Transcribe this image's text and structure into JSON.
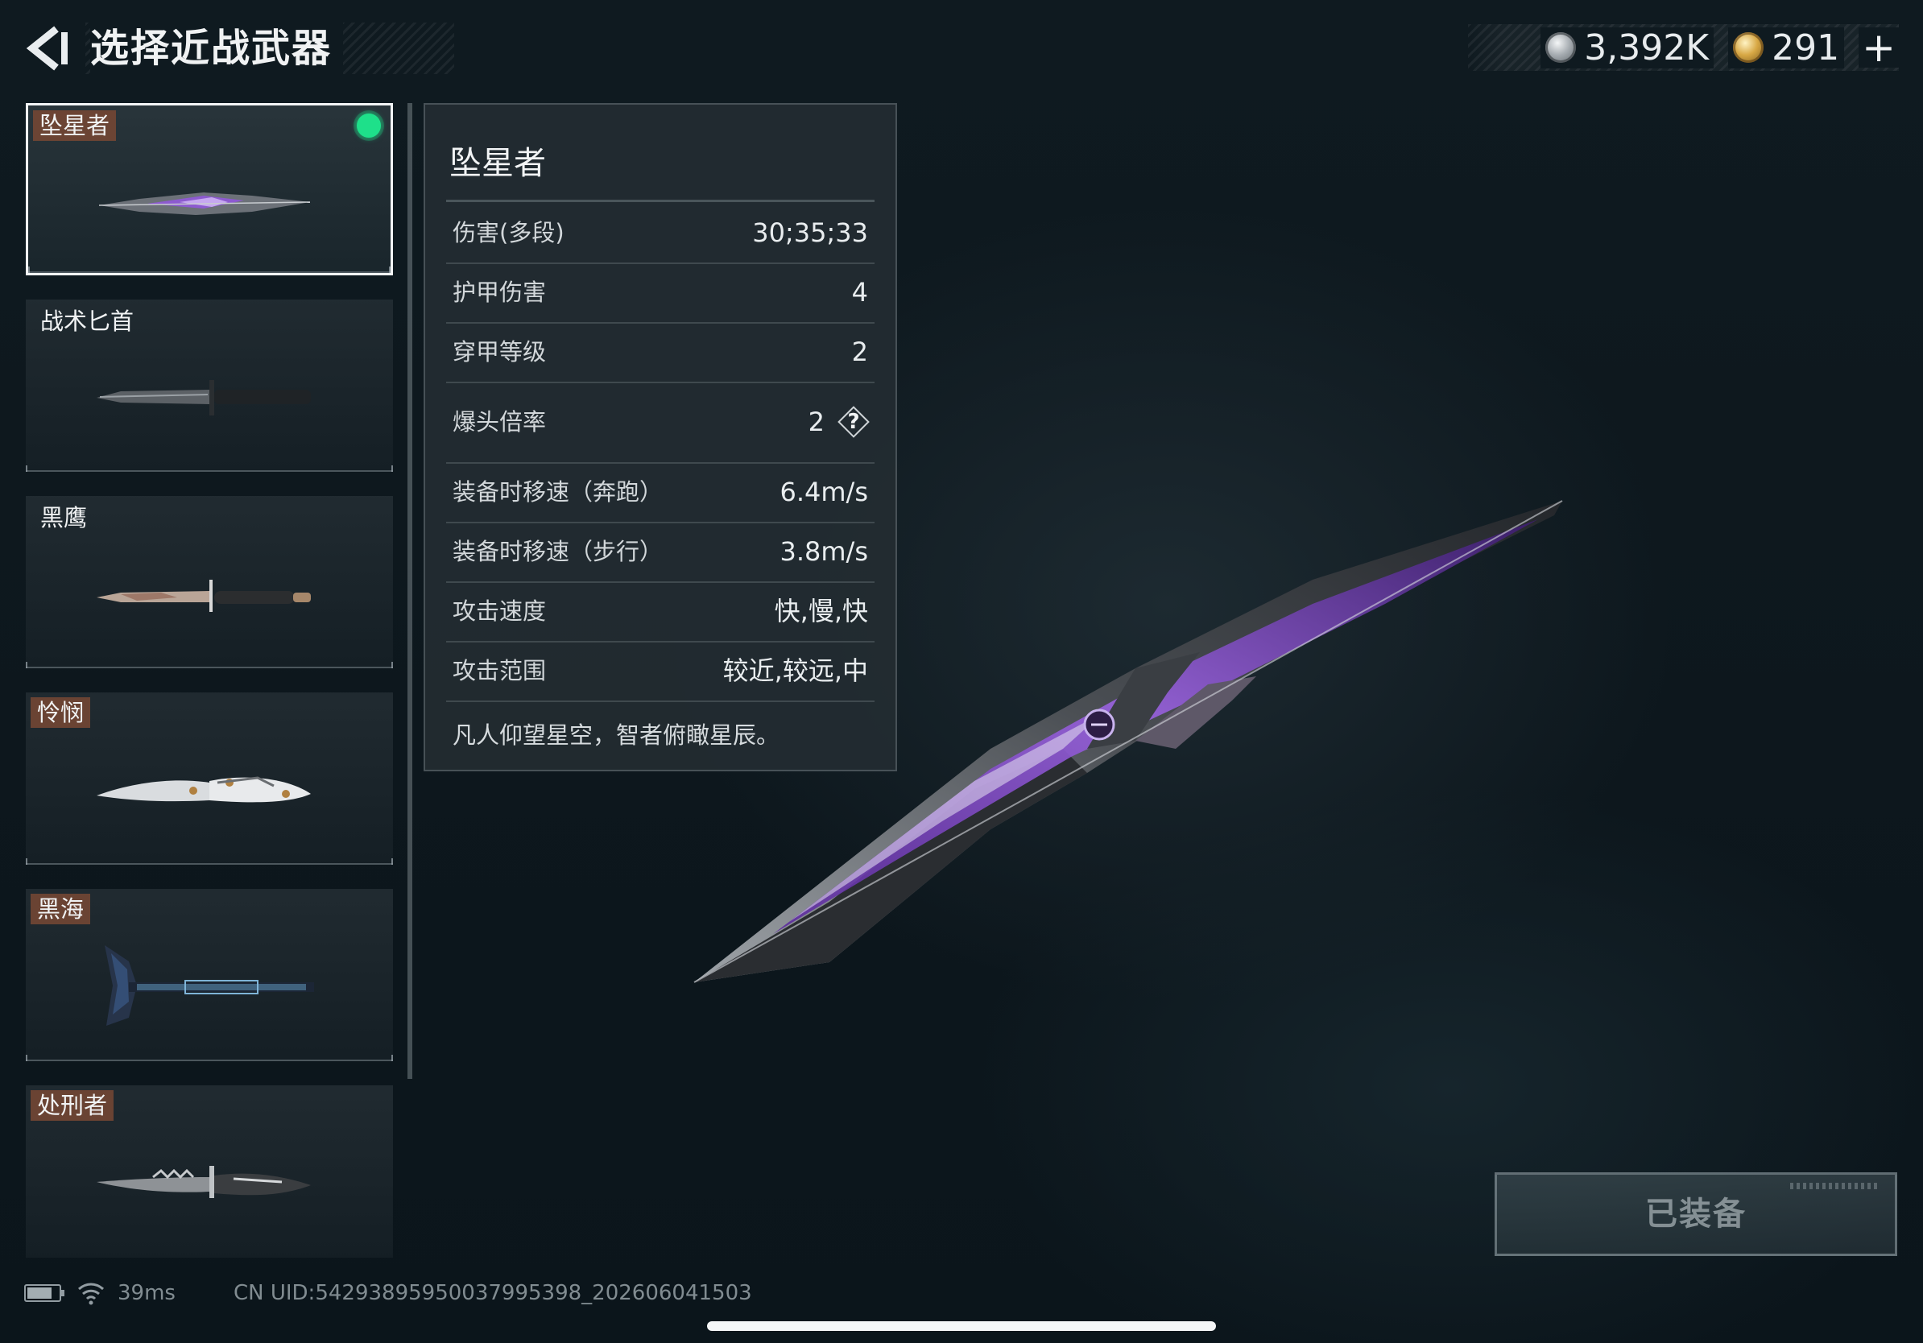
{
  "header": {
    "title": "选择近战武器",
    "currencies": [
      {
        "icon": "silver-coin-icon",
        "amount": "3,392K"
      },
      {
        "icon": "gold-coin-icon",
        "amount": "291"
      }
    ],
    "add_label": "+"
  },
  "weapons": [
    {
      "name": "坠星者",
      "selected": true,
      "equipped": true,
      "tag_color": "#7a4834"
    },
    {
      "name": "战术匕首",
      "selected": false,
      "equipped": false
    },
    {
      "name": "黑鹰",
      "selected": false,
      "equipped": false
    },
    {
      "name": "怜悯",
      "selected": false,
      "equipped": false,
      "tag_color": "#7a4834"
    },
    {
      "name": "黑海",
      "selected": false,
      "equipped": false,
      "tag_color": "#7a4834"
    },
    {
      "name": "处刑者",
      "selected": false,
      "equipped": false,
      "tag_color": "#7a4834"
    }
  ],
  "stats_panel": {
    "title": "坠星者",
    "rows": [
      {
        "label": "伤害(多段)",
        "value": "30;35;33"
      },
      {
        "label": "护甲伤害",
        "value": "4"
      },
      {
        "label": "穿甲等级",
        "value": "2"
      },
      {
        "label": "爆头倍率",
        "value": "2",
        "help": "?"
      },
      {
        "label": "装备时移速（奔跑）",
        "value": "6.4m/s"
      },
      {
        "label": "装备时移速（步行）",
        "value": "3.8m/s"
      },
      {
        "label": "攻击速度",
        "value": "快,慢,快"
      },
      {
        "label": "攻击范围",
        "value": "较近,较远,中"
      }
    ],
    "description": "凡人仰望星空，智者俯瞰星辰。"
  },
  "equip_button": {
    "label": "已装备"
  },
  "status": {
    "ping": "39ms",
    "uid": "CN UID:54293895950037995398_202606041503"
  },
  "colors": {
    "equipped_dot": "#1ee08a",
    "accent_purple": "#8a4fd0"
  }
}
